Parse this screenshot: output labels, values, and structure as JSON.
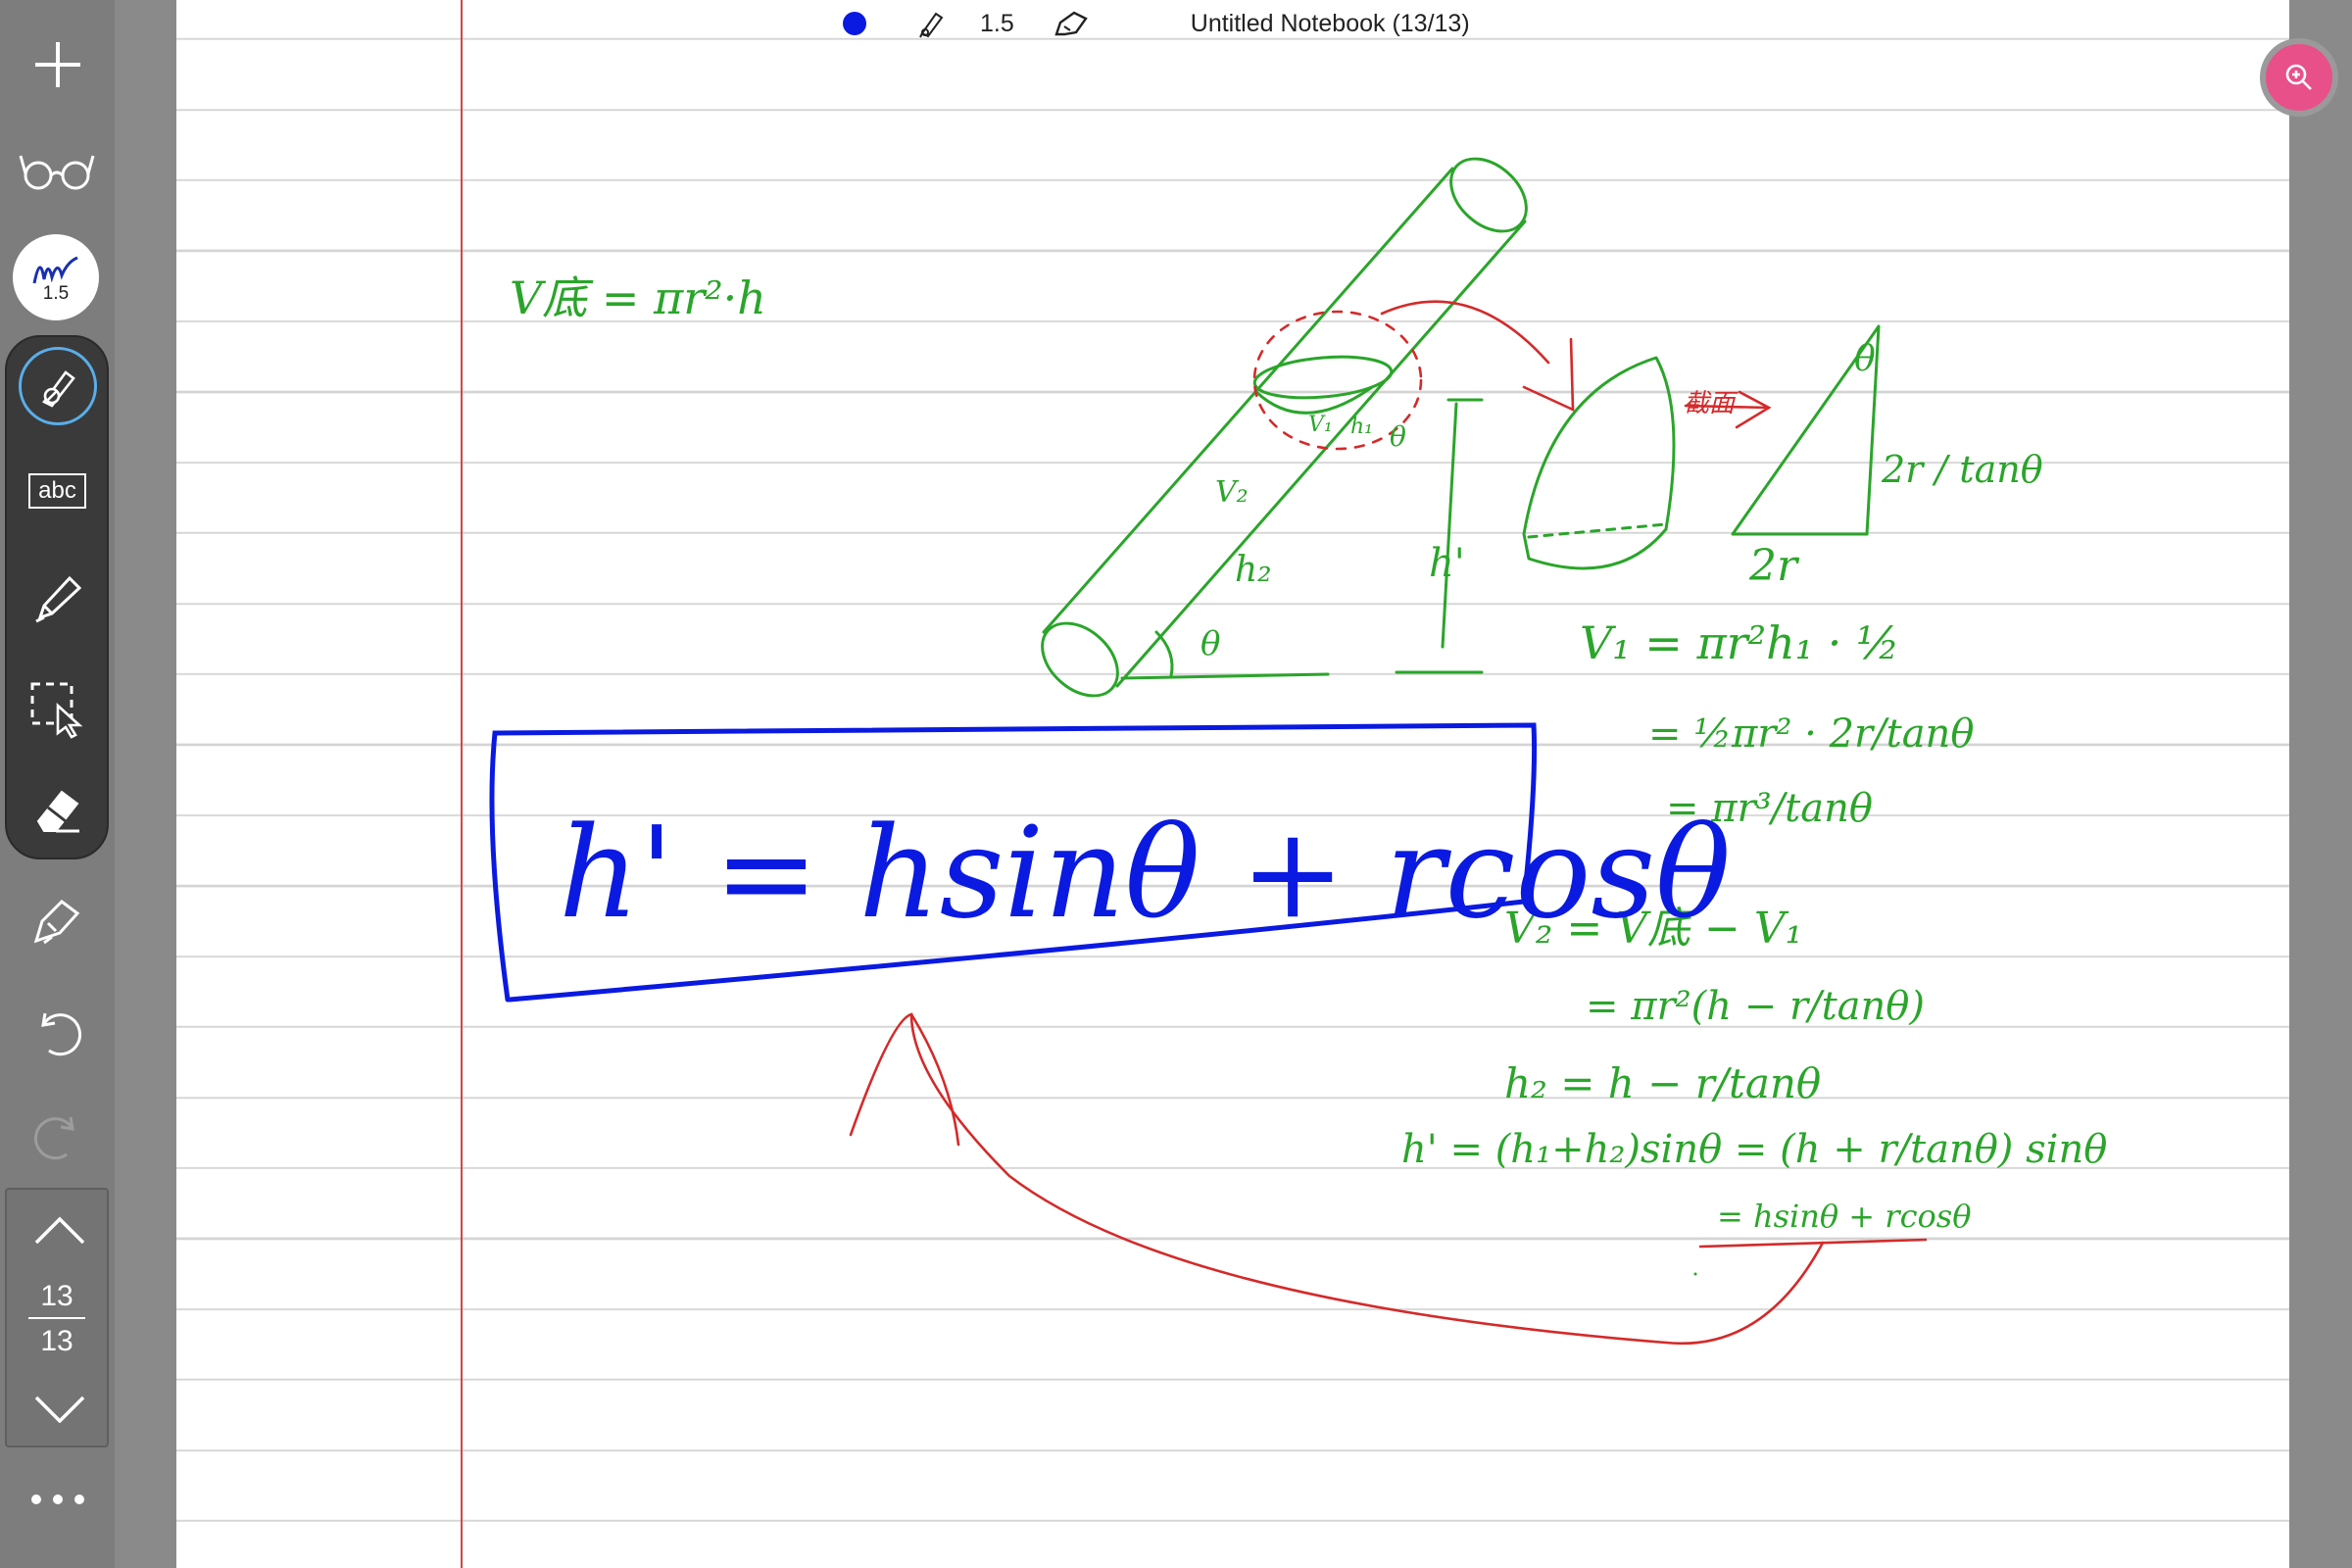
{
  "toolbar": {
    "pen_color": "#0a1ae0",
    "pen_size": "1.5",
    "notebook_title": "Untitled Notebook (13/13)"
  },
  "sidebar": {
    "pen_preview_size": "1.5",
    "text_tool_label": "abc"
  },
  "pager": {
    "current_page": "13",
    "total_pages": "13"
  },
  "ink_colors": {
    "green": "#2aa52a",
    "blue": "#0a1ae0",
    "red": "#d42a2a"
  },
  "notes": {
    "volume_formula": "V底 = πr²·h",
    "label_v1": "V₁",
    "label_v2": "V₂",
    "label_h1": "h₁",
    "label_h2": "h₂",
    "label_h_prime": "h'",
    "label_theta": "θ",
    "label_section": "截面",
    "label_2r": "2r",
    "label_2r_over_tan": "2r / tanθ",
    "v1_line1": "V₁ = πr²h₁ · ½",
    "v1_line2": "= ½πr² · 2r/tanθ",
    "v1_line3": "= πr³/tanθ",
    "v2_line1": "V₂ = V底 − V₁",
    "v2_line2": "= πr²(h − r/tanθ)",
    "h2_line": "h₂ = h − r/tanθ",
    "hprime_line1": "h' = (h₁+h₂)sinθ = (h + r/tanθ) sinθ",
    "hprime_line2": "= hsinθ + rcosθ",
    "boxed_result": "h' = hsinθ + rcosθ"
  }
}
